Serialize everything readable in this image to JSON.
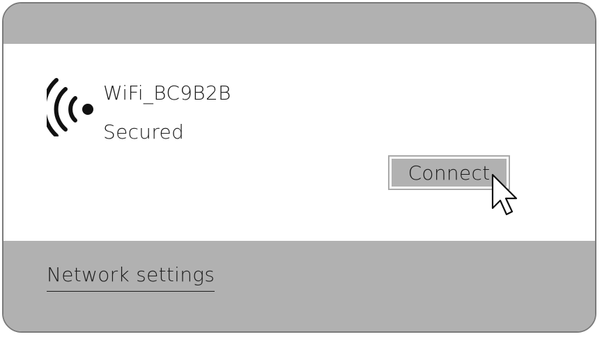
{
  "network": {
    "name": "WiFi_BC9B2B",
    "status": "Secured",
    "icon": "wifi-signal-icon"
  },
  "actions": {
    "connect_label": "Connect"
  },
  "footer": {
    "settings_link": "Network settings"
  },
  "colors": {
    "panel_gray": "#b1b1b1",
    "text": "#1c1c1c",
    "border": "#7a7a7a"
  },
  "pointer": {
    "icon": "mouse-pointer-icon"
  }
}
